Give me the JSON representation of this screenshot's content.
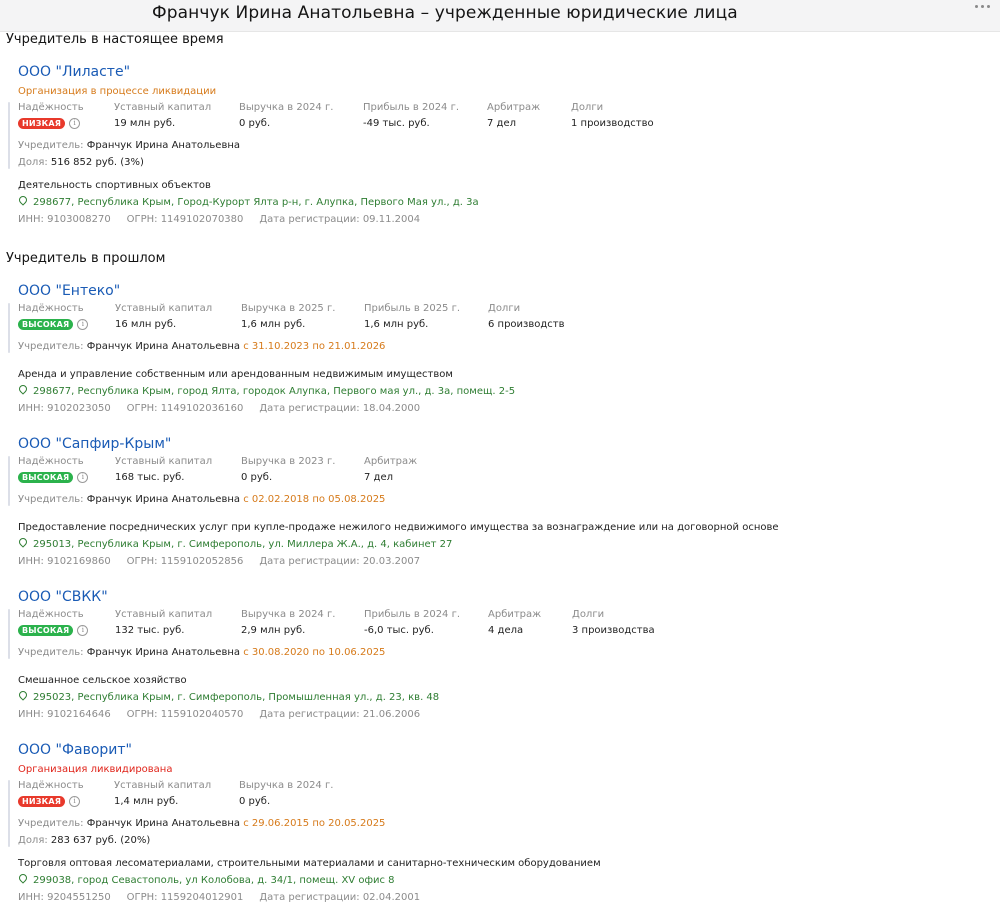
{
  "header": {
    "title": "Франчук Ирина Анатольевна – учрежденные юридические лица"
  },
  "sections": {
    "current": "Учредитель в настоящее время",
    "past": "Учредитель в прошлом"
  },
  "labels": {
    "founder": "Учредитель:",
    "share": "Доля:",
    "inn": "ИНН:",
    "ogrn": "ОГРН:",
    "reg_date": "Дата регистрации:"
  },
  "colors": {
    "link": "#1a5bb5",
    "low": "#e8392b",
    "high": "#2bb24c",
    "liquidation_process": "#d67a1a",
    "liquidated": "#e0251b",
    "address": "#2e7d32"
  },
  "companies": [
    {
      "name": "ООО \"Лиласте\"",
      "status": "Организация в процессе ликвидации",
      "reliability_label": "Надёжность",
      "reliability": "НИЗКАЯ",
      "stats": [
        {
          "label": "Уставный капитал",
          "value": "19 млн руб."
        },
        {
          "label": "Выручка в 2024 г.",
          "value": "0 руб."
        },
        {
          "label": "Прибыль в 2024 г.",
          "value": "-49 тыс. руб."
        },
        {
          "label": "Арбитраж",
          "value": "7 дел"
        },
        {
          "label": "Долги",
          "value": "1 производство"
        }
      ],
      "founder": "Франчук Ирина Анатольевна",
      "period": "",
      "share": "516 852 руб. (3%)",
      "activity": "Деятельность спортивных объектов",
      "address": "298677, Республика Крым, Город-Курорт Ялта р-н, г. Алупка, Первого Мая ул., д. 3а",
      "inn": "9103008270",
      "ogrn": "1149102070380",
      "reg_date": "09.11.2004"
    },
    {
      "name": "ООО \"Ентеко\"",
      "status": "",
      "reliability_label": "Надёжность",
      "reliability": "ВЫСОКАЯ",
      "stats": [
        {
          "label": "Уставный капитал",
          "value": "16 млн руб."
        },
        {
          "label": "Выручка в 2025 г.",
          "value": "1,6 млн руб."
        },
        {
          "label": "Прибыль в 2025 г.",
          "value": "1,6 млн руб."
        },
        {
          "label": "Долги",
          "value": "6 производств"
        }
      ],
      "founder": "Франчук Ирина Анатольевна",
      "period": "с 31.10.2023 по 21.01.2026",
      "share": "",
      "activity": "Аренда и управление собственным или арендованным недвижимым имуществом",
      "address": "298677, Республика Крым, город Ялта, городок Алупка, Первого мая ул., д. 3а, помещ. 2-5",
      "inn": "9102023050",
      "ogrn": "1149102036160",
      "reg_date": "18.04.2000"
    },
    {
      "name": "ООО \"Сапфир-Крым\"",
      "status": "",
      "reliability_label": "Надёжность",
      "reliability": "ВЫСОКАЯ",
      "stats": [
        {
          "label": "Уставный капитал",
          "value": "168 тыс. руб."
        },
        {
          "label": "Выручка в 2023 г.",
          "value": "0 руб."
        },
        {
          "label": "Арбитраж",
          "value": "7 дел"
        }
      ],
      "founder": "Франчук Ирина Анатольевна",
      "period": "с 02.02.2018 по 05.08.2025",
      "share": "",
      "activity": "Предоставление посреднических услуг при купле-продаже нежилого недвижимого имущества за вознаграждение или на договорной основе",
      "address": "295013, Республика Крым, г. Симферополь, ул. Миллера Ж.А., д. 4, кабинет 27",
      "inn": "9102169860",
      "ogrn": "1159102052856",
      "reg_date": "20.03.2007"
    },
    {
      "name": "ООО \"СВКК\"",
      "status": "",
      "reliability_label": "Надёжность",
      "reliability": "ВЫСОКАЯ",
      "stats": [
        {
          "label": "Уставный капитал",
          "value": "132 тыс. руб."
        },
        {
          "label": "Выручка в 2024 г.",
          "value": "2,9 млн руб."
        },
        {
          "label": "Прибыль в 2024 г.",
          "value": "-6,0 тыс. руб."
        },
        {
          "label": "Арбитраж",
          "value": "4 дела"
        },
        {
          "label": "Долги",
          "value": "3 производства"
        }
      ],
      "founder": "Франчук Ирина Анатольевна",
      "period": "с 30.08.2020 по 10.06.2025",
      "share": "",
      "activity": "Смешанное сельское хозяйство",
      "address": "295023, Республика Крым, г. Симферополь, Промышленная ул., д. 23, кв. 48",
      "inn": "9102164646",
      "ogrn": "1159102040570",
      "reg_date": "21.06.2006"
    },
    {
      "name": "ООО \"Фаворит\"",
      "status": "Организация ликвидирована",
      "reliability_label": "Надёжность",
      "reliability": "НИЗКАЯ",
      "stats": [
        {
          "label": "Уставный капитал",
          "value": "1,4 млн руб."
        },
        {
          "label": "Выручка в 2024 г.",
          "value": "0 руб."
        }
      ],
      "founder": "Франчук Ирина Анатольевна",
      "period": "с 29.06.2015 по 20.05.2025",
      "share": "283 637 руб. (20%)",
      "activity": "Торговля оптовая лесоматериалами, строительными материалами и санитарно-техническим оборудованием",
      "address": "299038, город Севастополь, ул Колобова, д. 34/1, помещ. XV офис 8",
      "inn": "9204551250",
      "ogrn": "1159204012901",
      "reg_date": "02.04.2001"
    }
  ]
}
